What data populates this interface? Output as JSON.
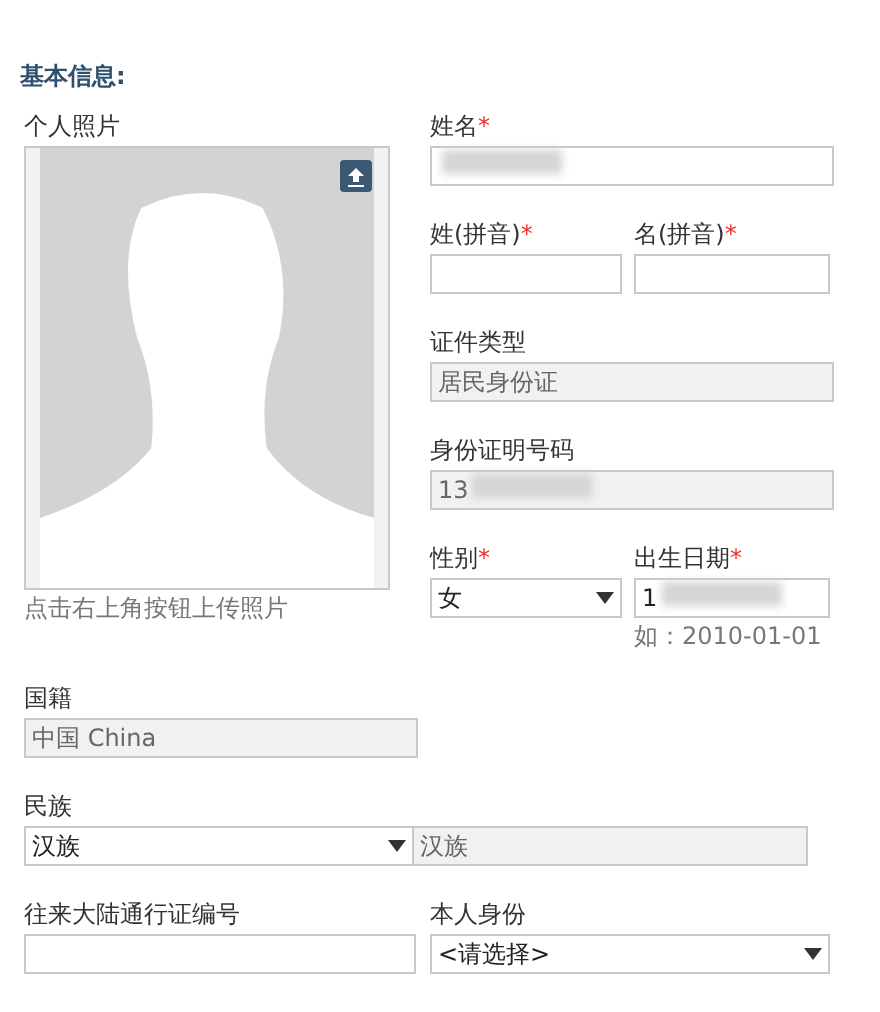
{
  "section_title": "基本信息:",
  "photo": {
    "label": "个人照片",
    "hint": "点击右上角按钮上传照片"
  },
  "name": {
    "label": "姓名",
    "required_mark": "*",
    "redacted": true
  },
  "surname_pinyin": {
    "label": "姓(拼音)",
    "required_mark": "*"
  },
  "given_pinyin": {
    "label": "名(拼音)",
    "required_mark": "*"
  },
  "id_type": {
    "label": "证件类型",
    "value": "居民身份证",
    "disabled": true
  },
  "id_number": {
    "label": "身份证明号码",
    "value": "13",
    "disabled": true,
    "redacted": true
  },
  "gender": {
    "label": "性别",
    "required_mark": "*",
    "value": "女"
  },
  "birth_date": {
    "label": "出生日期",
    "required_mark": "*",
    "value": "1",
    "redacted": true,
    "hint": "如：2010-01-01"
  },
  "nationality": {
    "label": "国籍",
    "value": "中国 China",
    "disabled": true
  },
  "ethnicity": {
    "label": "民族",
    "value": "汉族",
    "mirror": "汉族"
  },
  "permit_number": {
    "label": "往来大陆通行证编号"
  },
  "identity": {
    "label": "本人身份",
    "value": "<请选择>"
  }
}
